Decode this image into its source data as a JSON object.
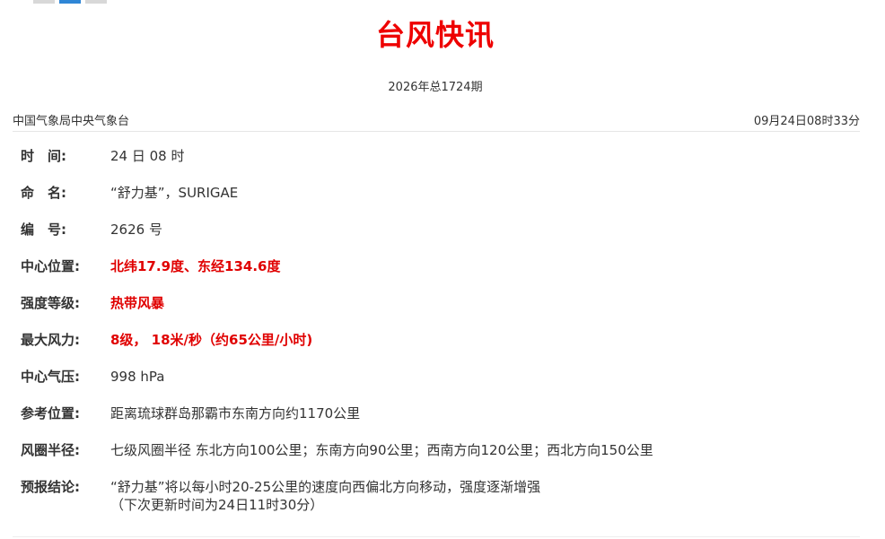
{
  "title": "台风快讯",
  "issue": "2026年总1724期",
  "issuer": "中国气象局中央气象台",
  "issue_time": "09月24日08时33分",
  "rows": [
    {
      "label": "时　间:",
      "value": "24 日 08 时"
    },
    {
      "label": "命　名:",
      "value": "“舒力基”，SURIGAE"
    },
    {
      "label": "编　号:",
      "value": "2626 号"
    },
    {
      "label": "中心位置:",
      "value": "北纬17.9度、东经134.6度"
    },
    {
      "label": "强度等级:",
      "value": "热带风暴"
    },
    {
      "label": "最大风力:",
      "value": "8级， 18米/秒（约65公里/小时)"
    },
    {
      "label": "中心气压:",
      "value": "998 hPa"
    },
    {
      "label": "参考位置:",
      "value": "距离琉球群岛那霸市东南方向约1170公里"
    },
    {
      "label": "风圈半径:",
      "value": "七级风圈半径 东北方向100公里；东南方向90公里；西南方向120公里；西北方向150公里"
    },
    {
      "label": "预报结论:",
      "value": "“舒力基”将以每小时20-25公里的速度向西偏北方向移动，强度逐渐增强",
      "value2": "（下次更新时间为24日11时30分）"
    }
  ],
  "colors": {
    "title": "#ee0000",
    "highlight": "#e00000",
    "tab_active": "#2f86d6"
  }
}
